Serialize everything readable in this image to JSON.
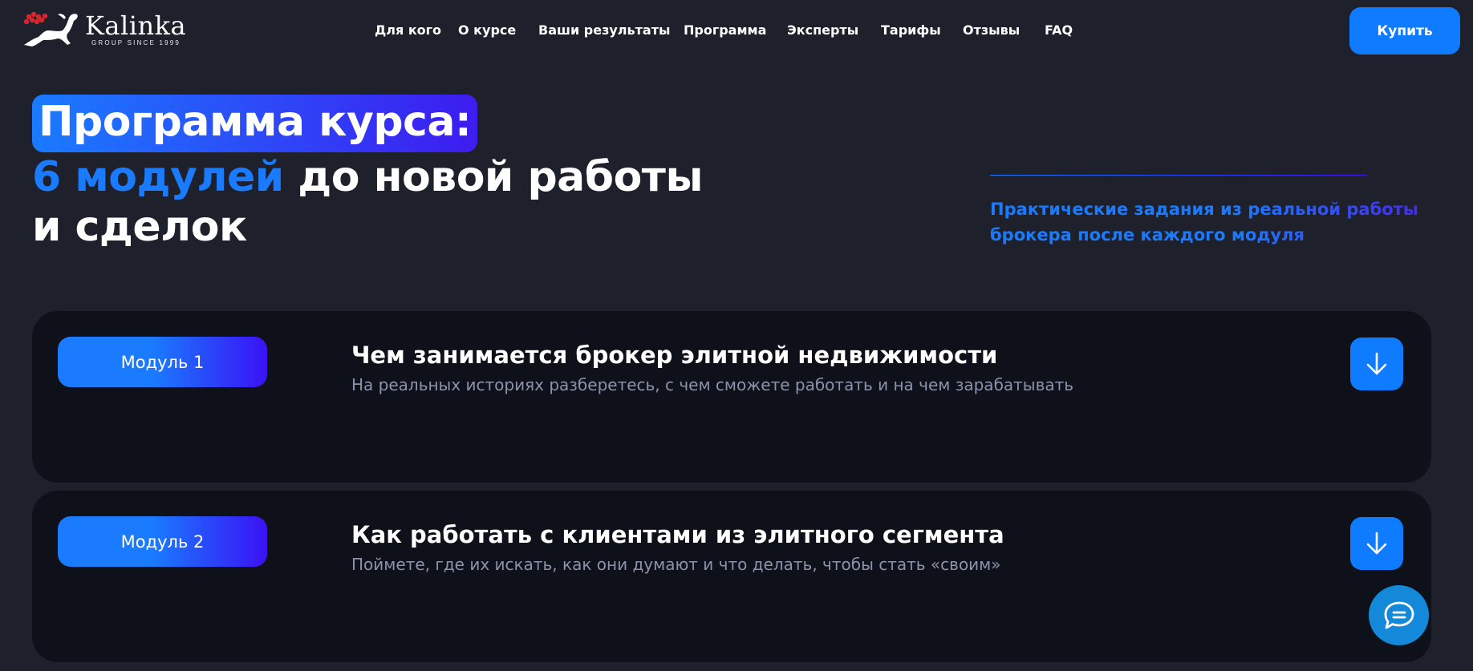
{
  "header": {
    "logo": {
      "name": "Kalinka",
      "tagline": "GROUP SINCE 1999",
      "icon": "horse-logo-icon"
    },
    "nav": [
      {
        "id": "for-whom",
        "label": "Для кого"
      },
      {
        "id": "about",
        "label": "О курсе"
      },
      {
        "id": "results",
        "label": "Ваши результаты"
      },
      {
        "id": "program",
        "label": "Программа"
      },
      {
        "id": "experts",
        "label": "Эксперты"
      },
      {
        "id": "tariffs",
        "label": "Тарифы"
      },
      {
        "id": "reviews",
        "label": "Отзывы"
      },
      {
        "id": "faq",
        "label": "FAQ"
      }
    ],
    "buy_label": "Купить"
  },
  "hero": {
    "title_highlight": "Программа курса:",
    "title_accent": "6 модулей",
    "title_rest": " до новой работы",
    "title_line3": "и сделок",
    "note": "Практические задания из реальной работы брокера после каждого модуля"
  },
  "modules": [
    {
      "label": "Модуль 1",
      "title": "Чем занимается брокер элитной недвижимости",
      "description": "На реальных историях разберетесь, с чем сможете работать и на чем зарабатывать",
      "icon": "arrow-down-icon"
    },
    {
      "label": "Модуль 2",
      "title": "Как работать с клиентами из элитного сегмента",
      "description": "Поймете, где их искать, как они думают и что делать, чтобы стать «своим»",
      "icon": "arrow-down-icon"
    }
  ],
  "chat": {
    "icon": "chat-bubble-icon"
  },
  "colors": {
    "background": "#1e212c",
    "card": "#0f111a",
    "accent_blue": "#0f7bff",
    "accent_violet": "#3d1cf0",
    "muted_text": "#8b93ab",
    "chat": "#1589d9"
  }
}
